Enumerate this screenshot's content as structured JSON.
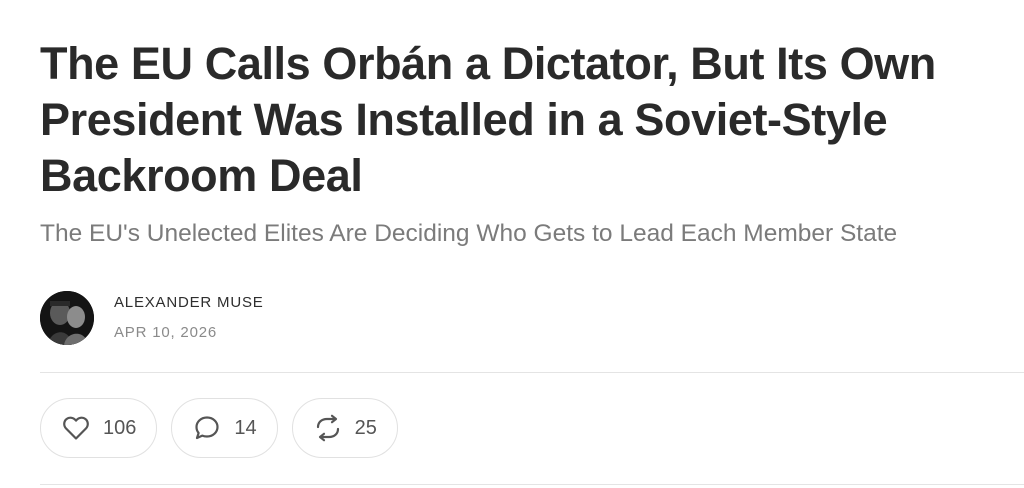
{
  "post": {
    "title": "The EU Calls Orbán a Dictator, But Its Own President Was Installed in a Soviet-Style Backroom Deal",
    "subtitle": "The EU's Unelected Elites Are Deciding Who Gets to Lead Each Member State"
  },
  "author": {
    "name": "ALEXANDER MUSE",
    "date": "APR 10, 2026",
    "avatar_icon": "author-avatar-photo"
  },
  "actions": {
    "likes": {
      "icon": "heart-icon",
      "count": "106"
    },
    "comments": {
      "icon": "comment-bubble-icon",
      "count": "14"
    },
    "restacks": {
      "icon": "restack-arrows-icon",
      "count": "25"
    }
  },
  "colors": {
    "title": "#2a2a2a",
    "subtitle": "#7b7b7b",
    "meta": "#8a8a8a",
    "border": "#e1e1e1",
    "icon": "#555555"
  }
}
